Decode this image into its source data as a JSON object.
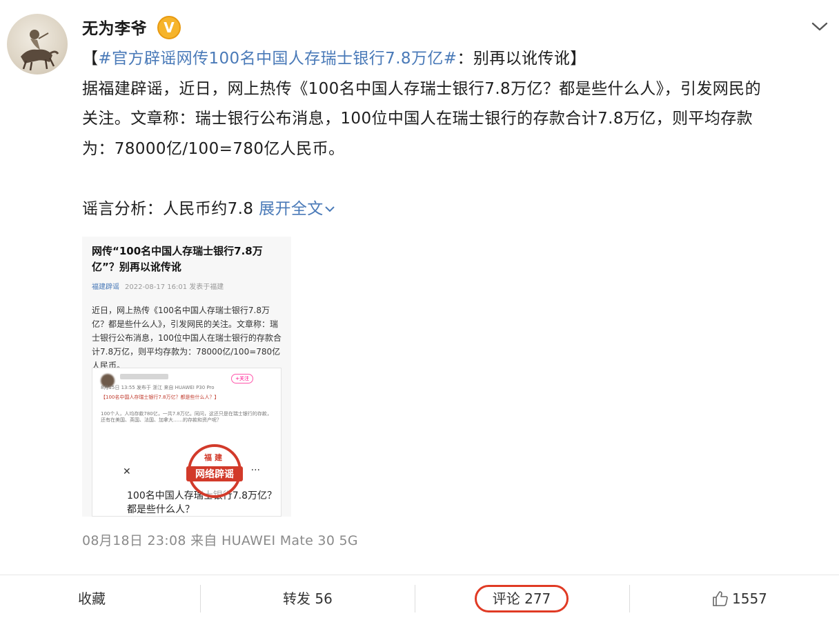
{
  "author": {
    "name": "无为李爷",
    "badge": "V"
  },
  "post": {
    "line1_open": "【",
    "hashtag": "#官方辟谣网传100名中国人存瑞士银行7.8万亿#",
    "line1_rest": "：别再以讹传讹】",
    "line2": "据福建辟谣，近日，网上热传《100名中国人存瑞士银行7.8万亿？都是些什么人》，引发网民的",
    "line3": "关注。文章称：瑞士银行公布消息，100位中国人在瑞士银行的存款合计7.8万亿，则平均存款",
    "line4": "为：78000亿/100=780亿人民币。",
    "line5": "谣言分析：人民币约7.8",
    "expand_label": "展开全文"
  },
  "thumbnail": {
    "title": "网传“100名中国人存瑞士银行7.8万亿”？别再以讹传讹",
    "source": "福建辟谣",
    "meta": "2022-08-17 16:01  发表于福建",
    "body": "近日，网上热传《100名中国人存瑞士银行7.8万亿？都是些什么人》，引发网民的关注。文章称：瑞士银行公布消息，100位中国人在瑞士银行的存款合计7.8万亿，则平均存款为：78000亿/100=780亿人民币。",
    "inner_follow": "+关注",
    "inner_line1": "8月15日 13:55 发布于 浙江 来自 HUAWEI P30 Pro",
    "inner_line2": "【100名中国人存瑞士银行7.8万亿？都是些什么人？】",
    "inner_line3": "100个人，人均存款780亿，一共7.8万亿。同问，这还只是在瑞士银行的存款，还有在美国、英国、法国、加拿大……的存款和资产呢？",
    "inner_big": "100名中国人存瑞士银行7.8万亿？都是些什么人？",
    "stamp_top": "福建",
    "stamp_main": "网络辟谣"
  },
  "timestamp": "08月18日 23:08  来自 HUAWEI Mate 30 5G",
  "actions": {
    "favorite": "收藏",
    "repost": "转发 56",
    "comment": "评论 277",
    "like_count": "1557"
  },
  "colors": {
    "link": "#4a7ab8",
    "highlight": "#e03a24",
    "badge": "#f6b42b"
  }
}
